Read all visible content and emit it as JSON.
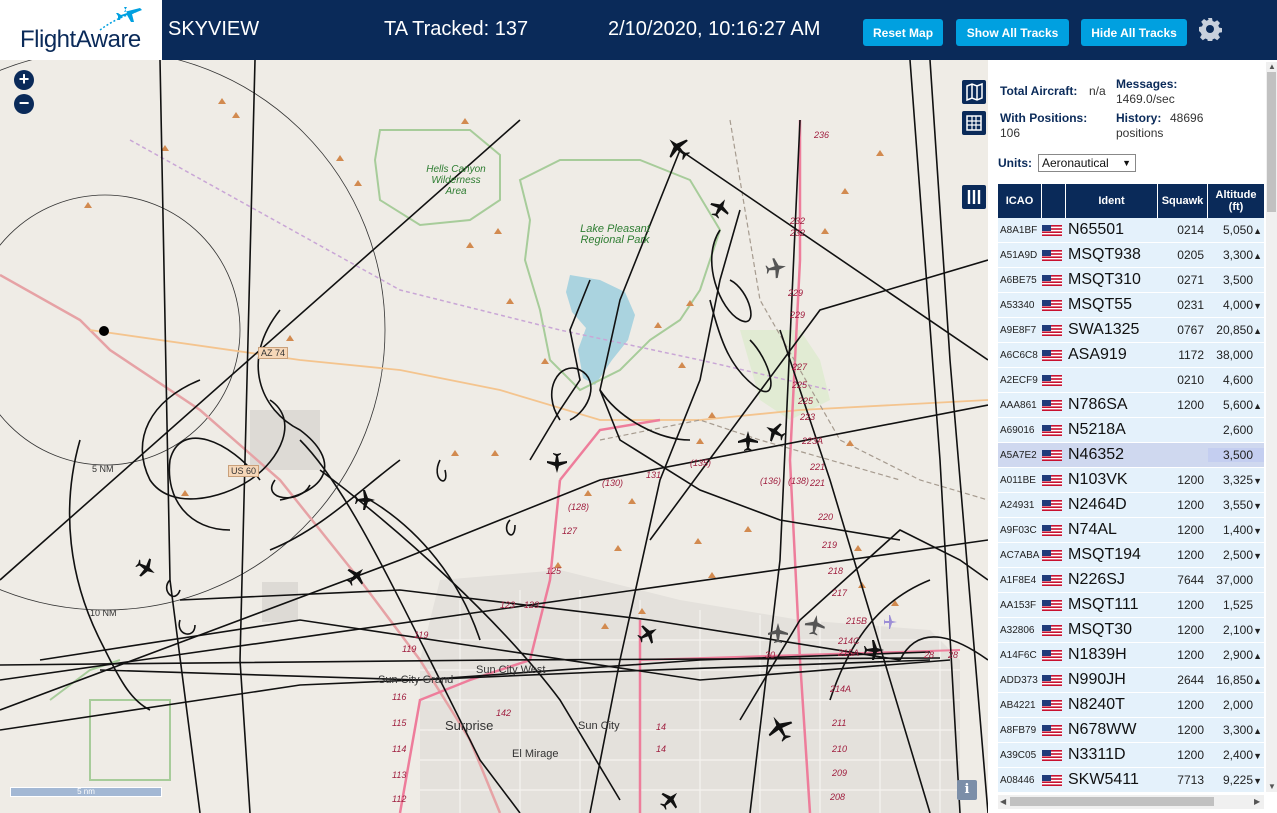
{
  "header": {
    "logo": "FlightAware",
    "app_name": "SKYVIEW",
    "tracked": "TA Tracked: 137",
    "datetime": "2/10/2020, 10:16:27 AM",
    "buttons": {
      "reset_map": "Reset Map",
      "show_all": "Show All Tracks",
      "hide_all": "Hide All Tracks"
    }
  },
  "map": {
    "zoom_in": "+",
    "zoom_out": "−",
    "scale": "5 nm",
    "info": "i",
    "range_rings": [
      "5 NM",
      "10 NM"
    ],
    "places": [
      "Surprise",
      "Sun City West",
      "Sun City Grand",
      "Sun City",
      "El Mirage"
    ],
    "parks": [
      "Hells Canyon Wilderness Area",
      "Lake Pleasant Regional Park"
    ],
    "shields": [
      "AZ 74",
      "US 60"
    ],
    "routes": [
      "236",
      "232",
      "232",
      "229",
      "229",
      "227",
      "225",
      "225",
      "223",
      "223A",
      "221",
      "221",
      "220",
      "219",
      "218",
      "217",
      "215B",
      "214C",
      "215A",
      "214A",
      "211",
      "210",
      "209",
      "208",
      "(135)",
      "(130)",
      "(136)",
      "(138)",
      "(128)",
      "127",
      "131",
      "125",
      "123",
      "123",
      "119",
      "119",
      "116",
      "115",
      "114",
      "113",
      "112",
      "142",
      "14",
      "14",
      "28",
      "28",
      "30"
    ]
  },
  "sidebar": {
    "total_aircraft_label": "Total Aircraft:",
    "total_aircraft_value": "n/a",
    "messages_label": "Messages:",
    "messages_value": "1469.0/sec",
    "positions_label": "With Positions:",
    "positions_value": "106",
    "history_label": "History:",
    "history_value": "48696",
    "history_unit": "positions",
    "units_label": "Units:",
    "units_value": "Aeronautical",
    "columns": [
      "ICAO",
      "Ident",
      "Squawk",
      "Altitude (ft)"
    ],
    "rows": [
      {
        "icao": "A8A1BF",
        "ident": "N65501",
        "squawk": "0214",
        "alt": "5,050",
        "trend": "▲"
      },
      {
        "icao": "A51A9D",
        "ident": "MSQT938",
        "squawk": "0205",
        "alt": "3,300",
        "trend": "▲"
      },
      {
        "icao": "A6BE75",
        "ident": "MSQT310",
        "squawk": "0271",
        "alt": "3,500",
        "trend": ""
      },
      {
        "icao": "A53340",
        "ident": "MSQT55",
        "squawk": "0231",
        "alt": "4,000",
        "trend": "▼"
      },
      {
        "icao": "A9E8F7",
        "ident": "SWA1325",
        "squawk": "0767",
        "alt": "20,850",
        "trend": "▲"
      },
      {
        "icao": "A6C6C8",
        "ident": "ASA919",
        "squawk": "1172",
        "alt": "38,000",
        "trend": ""
      },
      {
        "icao": "A2ECF9",
        "ident": "",
        "squawk": "0210",
        "alt": "4,600",
        "trend": ""
      },
      {
        "icao": "AAA861",
        "ident": "N786SA",
        "squawk": "1200",
        "alt": "5,600",
        "trend": "▲"
      },
      {
        "icao": "A69016",
        "ident": "N5218A",
        "squawk": "",
        "alt": "2,600",
        "trend": ""
      },
      {
        "icao": "A5A7E2",
        "ident": "N46352",
        "squawk": "",
        "alt": "3,500",
        "trend": "",
        "selected": true
      },
      {
        "icao": "A011BE",
        "ident": "N103VK",
        "squawk": "1200",
        "alt": "3,325",
        "trend": "▼"
      },
      {
        "icao": "A24931",
        "ident": "N2464D",
        "squawk": "1200",
        "alt": "3,550",
        "trend": "▼"
      },
      {
        "icao": "A9F03C",
        "ident": "N74AL",
        "squawk": "1200",
        "alt": "1,400",
        "trend": "▼"
      },
      {
        "icao": "AC7ABA",
        "ident": "MSQT194",
        "squawk": "1200",
        "alt": "2,500",
        "trend": "▼"
      },
      {
        "icao": "A1F8E4",
        "ident": "N226SJ",
        "squawk": "7644",
        "alt": "37,000",
        "trend": ""
      },
      {
        "icao": "AA153F",
        "ident": "MSQT111",
        "squawk": "1200",
        "alt": "1,525",
        "trend": ""
      },
      {
        "icao": "A32806",
        "ident": "MSQT30",
        "squawk": "1200",
        "alt": "2,100",
        "trend": "▼"
      },
      {
        "icao": "A14F6C",
        "ident": "N1839H",
        "squawk": "1200",
        "alt": "2,900",
        "trend": "▲"
      },
      {
        "icao": "ADD373",
        "ident": "N990JH",
        "squawk": "2644",
        "alt": "16,850",
        "trend": "▲"
      },
      {
        "icao": "AB4221",
        "ident": "N8240T",
        "squawk": "1200",
        "alt": "2,000",
        "trend": ""
      },
      {
        "icao": "A8FB79",
        "ident": "N678WW",
        "squawk": "1200",
        "alt": "3,300",
        "trend": "▲"
      },
      {
        "icao": "A39C05",
        "ident": "N3311D",
        "squawk": "1200",
        "alt": "2,400",
        "trend": "▼"
      },
      {
        "icao": "A08446",
        "ident": "SKW5411",
        "squawk": "7713",
        "alt": "9,225",
        "trend": "▼"
      }
    ]
  },
  "colors": {
    "header_bg": "#0a2a59",
    "button_bg": "#00a0e0",
    "row_bg": "#e4f1fb",
    "row_selected": "#cfd8ef"
  }
}
